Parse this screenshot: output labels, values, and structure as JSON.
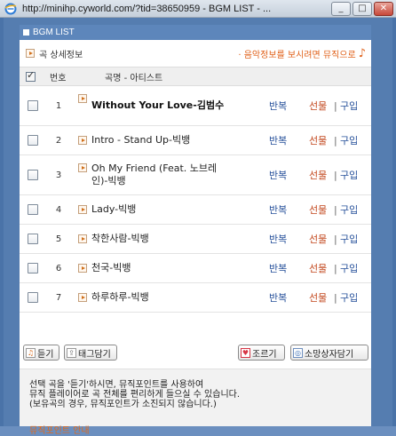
{
  "window": {
    "title": "http://minihp.cyworld.com/?tid=38650959 - BGM LIST - ..."
  },
  "header": {
    "label": "BGM LIST"
  },
  "info_bar": {
    "song_info_label": "곡 상세정보",
    "music_info_label": "· 음악정보를 보시려면 뮤직으로",
    "note_glyph": "♪"
  },
  "table_head": {
    "number": "번호",
    "title": "곡명 - 아티스트"
  },
  "songs": [
    {
      "num": "1",
      "title": "Without Your Love-김범수",
      "repeat": "반복",
      "gift": "선물",
      "sep": "|",
      "buy": "구입"
    },
    {
      "num": "2",
      "title": "Intro - Stand Up-빅뱅",
      "repeat": "반복",
      "gift": "선물",
      "sep": "|",
      "buy": "구입"
    },
    {
      "num": "3",
      "title": "Oh My Friend (Feat. 노브레인)-빅뱅",
      "repeat": "반복",
      "gift": "선물",
      "sep": "|",
      "buy": "구입"
    },
    {
      "num": "4",
      "title": "Lady-빅뱅",
      "repeat": "반복",
      "gift": "선물",
      "sep": "|",
      "buy": "구입"
    },
    {
      "num": "5",
      "title": "착한사람-빅뱅",
      "repeat": "반복",
      "gift": "선물",
      "sep": "|",
      "buy": "구입"
    },
    {
      "num": "6",
      "title": "천국-빅뱅",
      "repeat": "반복",
      "gift": "선물",
      "sep": "|",
      "buy": "구입"
    },
    {
      "num": "7",
      "title": "하루하루-빅뱅",
      "repeat": "반복",
      "gift": "선물",
      "sep": "|",
      "buy": "구입"
    }
  ],
  "buttons": {
    "listen": "듣기",
    "tag": "태그담기",
    "beg": "조르기",
    "wishlist": "소망상자담기"
  },
  "notice": {
    "line1": "선택 곡을 '듣기'하시면, 뮤직포인트를 사용하여",
    "line2": "뮤직 플레이어로 곡 전체를 편리하게 들으실 수 있습니다.",
    "line3": "(보유곡의 경우, 뮤직포인트가 소진되지 않습니다.)",
    "link": "뮤직포인트 안내"
  },
  "colors": {
    "frame": "#557db0",
    "accent_orange": "#e0611a",
    "link_blue": "#26509a"
  }
}
